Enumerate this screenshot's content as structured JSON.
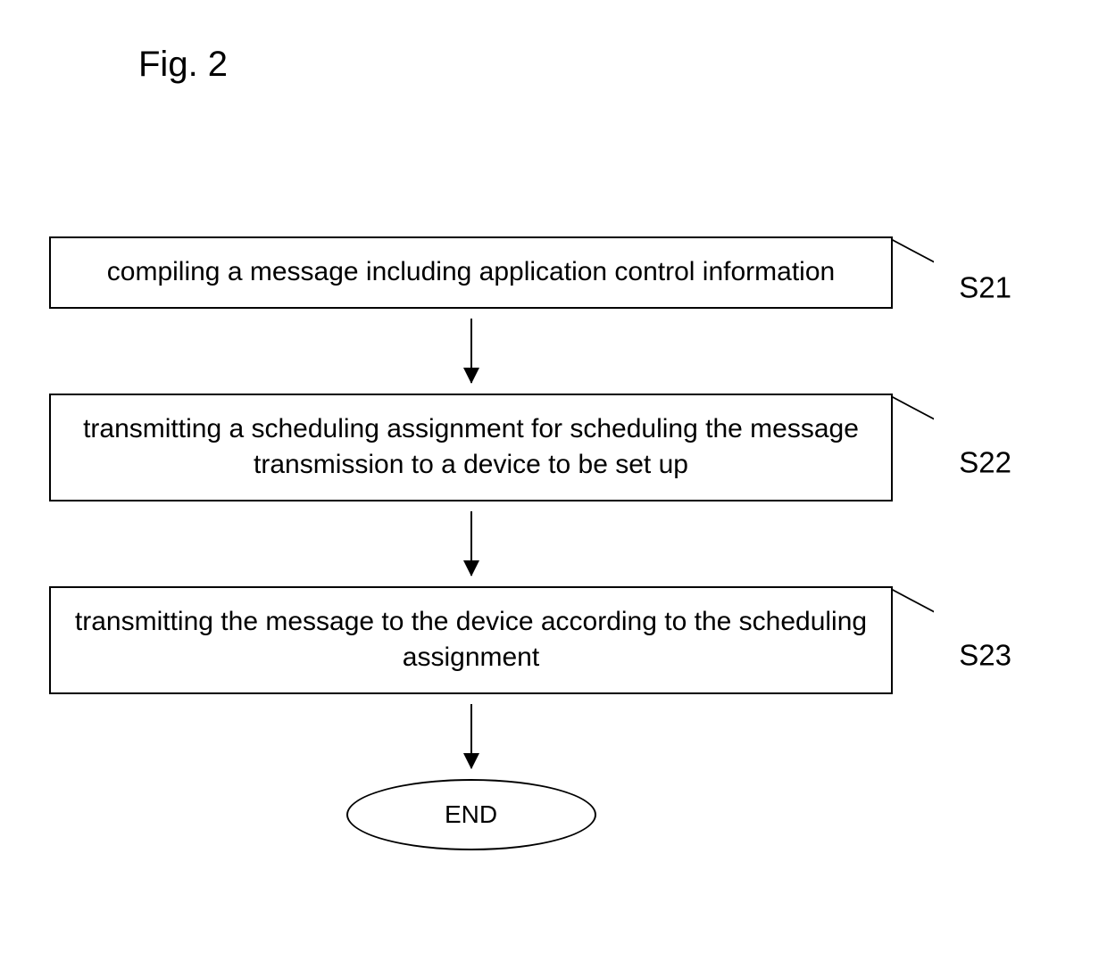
{
  "figure_title": "Fig. 2",
  "steps": [
    {
      "text": "compiling a message including application control information",
      "label": "S21"
    },
    {
      "text": "transmitting a scheduling assignment for scheduling the message transmission to a device to be set up",
      "label": "S22"
    },
    {
      "text": "transmitting the message to the device according to the scheduling assignment",
      "label": "S23"
    }
  ],
  "terminal": "END"
}
